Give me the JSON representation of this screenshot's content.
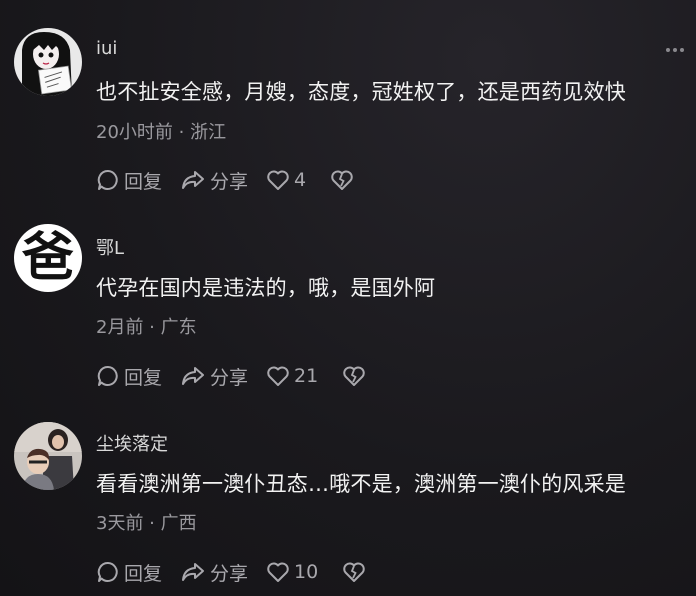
{
  "comments": [
    {
      "username": "iui",
      "avatar_sign_text": "宝宝的\n宝宝",
      "content": "也不扯安全感，月嫂，态度，冠姓权了，还是西药见效快",
      "time": "20小时前",
      "location": "浙江",
      "reply_label": "回复",
      "share_label": "分享",
      "like_count": "4"
    },
    {
      "username": "鄂L",
      "avatar_glyph": "爸",
      "content": "代孕在国内是违法的，哦，是国外阿",
      "time": "2月前",
      "location": "广东",
      "reply_label": "回复",
      "share_label": "分享",
      "like_count": "21"
    },
    {
      "username": "尘埃落定",
      "content": "看看澳洲第一澳仆丑态…哦不是，澳洲第一澳仆的风采是",
      "time": "3天前",
      "location": "广西",
      "reply_label": "回复",
      "share_label": "分享",
      "like_count": "10"
    }
  ],
  "meta_separator": " · ",
  "icons": {
    "reply": "reply-bubble-icon",
    "share": "share-arrow-icon",
    "like": "heart-outline-icon",
    "dislike": "broken-heart-icon",
    "more": "more-dots-icon"
  },
  "colors": {
    "background": "#17161a",
    "primary_text": "#f2f2f2",
    "secondary_text": "#9a999e",
    "action_text": "#a9a8ad"
  }
}
